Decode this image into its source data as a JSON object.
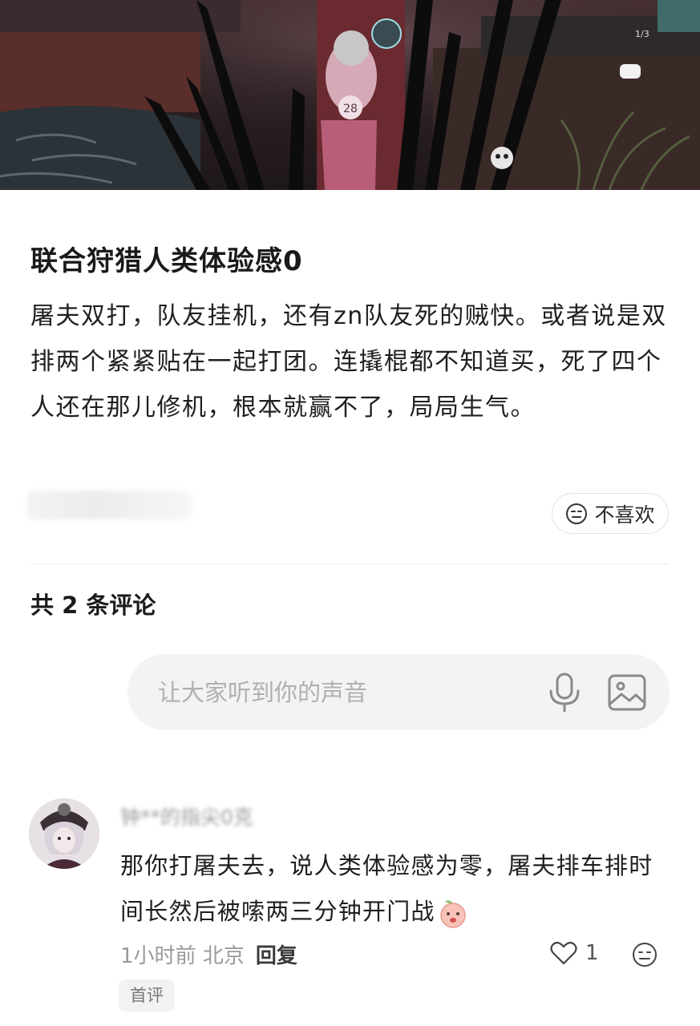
{
  "hero": {
    "badge_number": "28",
    "page_indicator": "1/3",
    "description_icon": "game-screenshot"
  },
  "post": {
    "title": "联合狩猎人类体验感0",
    "body": "屠夫双打，队友挂机，还有zn队友死的贼快。或者说是双排两个紧紧贴在一起打团。连撬棍都不知道买，死了四个人还在那儿修机，根本就赢不了，局局生气。",
    "dislike_label": "不喜欢"
  },
  "comments_header": {
    "count_label": "共 2 条评论"
  },
  "comment_input": {
    "placeholder": "让大家听到你的声音"
  },
  "comment": {
    "author": "钟**的指尖0克",
    "text": "那你打屠夫去，说人类体验感为零，屠夫排车排时间长然后被嗦两三分钟开门战",
    "time": "1小时前",
    "location": "北京",
    "reply_label": "回复",
    "like_count": "1",
    "badge": "首评"
  },
  "colors": {
    "accent_text": "#1c1c1c",
    "muted_text": "#9a9a9a",
    "input_bg": "#f3f3f5"
  }
}
